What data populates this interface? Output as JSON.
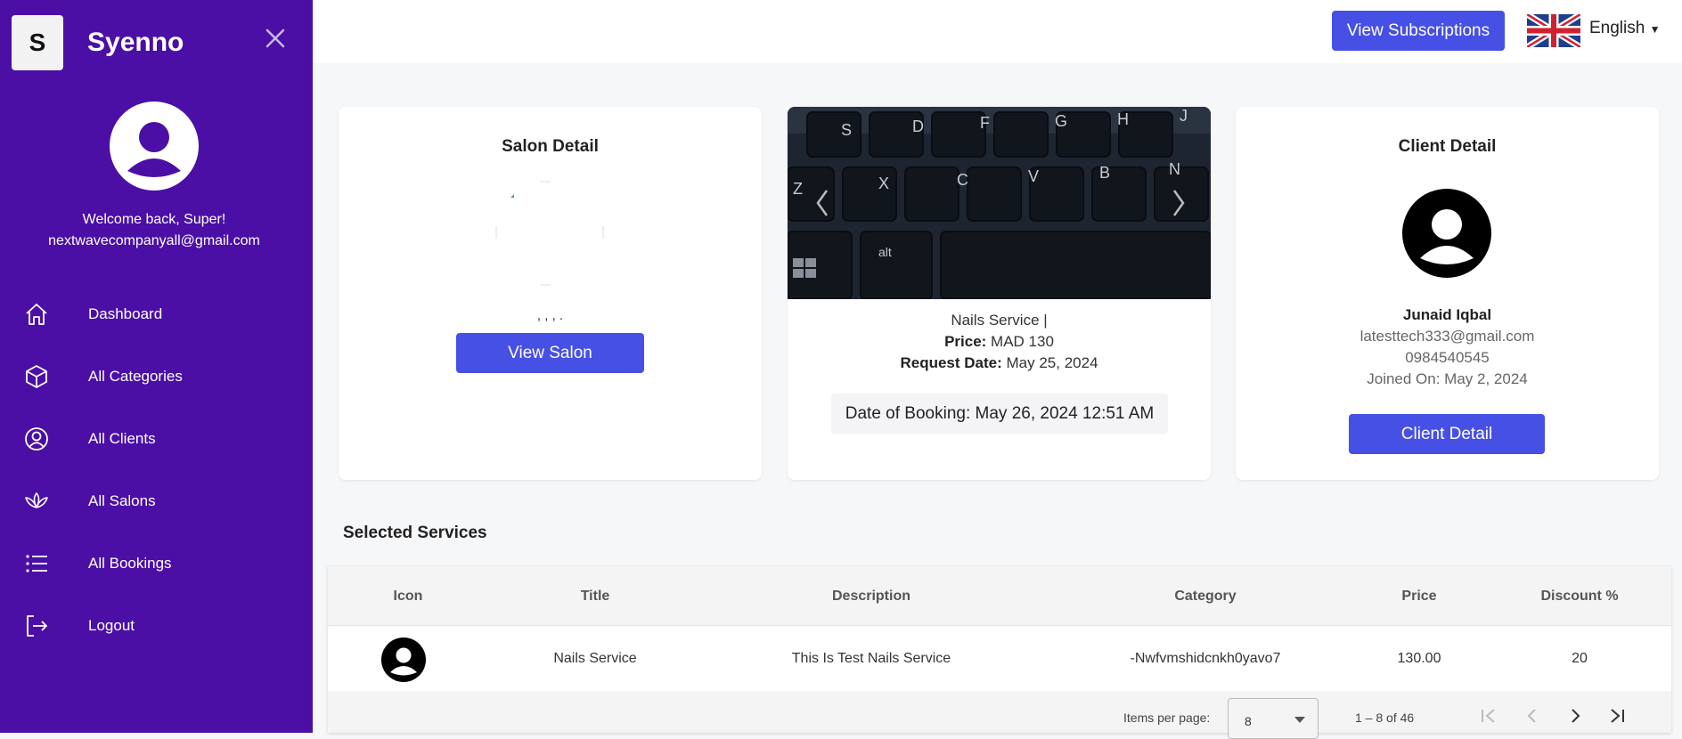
{
  "sidebar": {
    "logo_letter": "S",
    "brand": "Syenno",
    "welcome": "Welcome back, Super!",
    "email": "nextwavecompanyall@gmail.com",
    "items": [
      {
        "label": "Dashboard",
        "icon": "home-icon"
      },
      {
        "label": "All Categories",
        "icon": "cube-icon"
      },
      {
        "label": "All Clients",
        "icon": "user-circle-icon"
      },
      {
        "label": "All Salons",
        "icon": "lotus-icon"
      },
      {
        "label": "All Bookings",
        "icon": "list-icon"
      },
      {
        "label": "Logout",
        "icon": "logout-icon"
      }
    ]
  },
  "topbar": {
    "subscriptions_label": "View Subscriptions",
    "language": "English"
  },
  "salon_card": {
    "title": "Salon Detail",
    "address": ", , , .",
    "button": "View Salon"
  },
  "booking_card": {
    "service": "Nails Service |",
    "price_label": "Price:",
    "price": "MAD 130",
    "request_label": "Request Date:",
    "request_date": "May 25, 2024",
    "booking_date": "Date of Booking: May 26, 2024 12:51 AM"
  },
  "client_card": {
    "title": "Client Detail",
    "name": "Junaid Iqbal",
    "email": "latesttech333@gmail.com",
    "phone": "0984540545",
    "joined": "Joined On: May 2, 2024",
    "button": "Client Detail"
  },
  "services": {
    "title": "Selected Services",
    "columns": [
      "Icon",
      "Title",
      "Description",
      "Category",
      "Price",
      "Discount %"
    ],
    "rows": [
      {
        "title": "Nails Service",
        "description": "This Is Test Nails Service",
        "category": "-Nwfvmshidcnkh0yavo7",
        "price": "130.00",
        "discount": "20"
      }
    ],
    "pager": {
      "items_label": "Items per page:",
      "items_value": "8",
      "range": "1 – 8 of 46"
    }
  },
  "colors": {
    "sidebar": "#4b0fa6",
    "primary": "#4650e4"
  }
}
